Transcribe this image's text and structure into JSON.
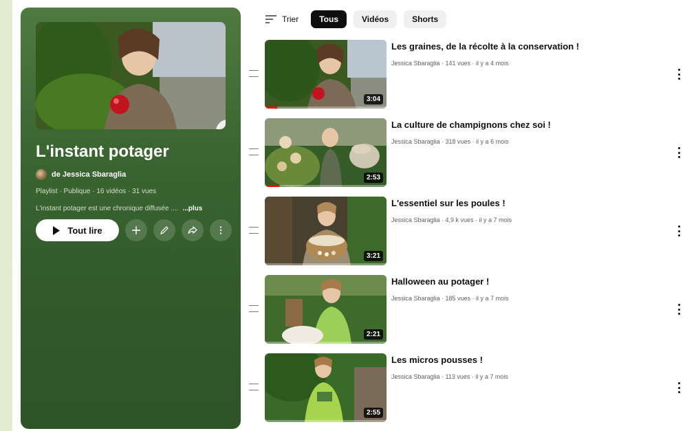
{
  "playlist": {
    "title": "L'instant potager",
    "owner": "de Jessica Sbaraglia",
    "meta": "Playlist · Publique · 16 vidéos · 31 vues",
    "description": "L'instant potager est une chronique diffusée ....",
    "description_more": "...plus",
    "play_all_label": "Tout lire",
    "hero_progress": 1.0
  },
  "filters": {
    "sort_label": "Trier",
    "chips": [
      "Tous",
      "Vidéos",
      "Shorts"
    ],
    "active": "Tous"
  },
  "videos": [
    {
      "title": "Les graines, de la récolte à la conservation !",
      "meta": "Jessica Sbaraglia · 141 vues · il y a 4 mois",
      "duration": "3:04",
      "progress": 0.1
    },
    {
      "title": "La culture de champignons chez soi !",
      "meta": "Jessica Sbaraglia · 318 vues · il y a 6 mois",
      "duration": "2:53",
      "progress": 0.12
    },
    {
      "title": "L'essentiel sur les poules !",
      "meta": "Jessica Sbaraglia · 4,9 k vues · il y a 7 mois",
      "duration": "3:21",
      "progress": 0.0
    },
    {
      "title": "Halloween au potager !",
      "meta": "Jessica Sbaraglia · 185 vues · il y a 7 mois",
      "duration": "2:21",
      "progress": 0.0
    },
    {
      "title": "Les micros pousses !",
      "meta": "Jessica Sbaraglia · 113 vues · il y a 7 mois",
      "duration": "2:55",
      "progress": 0.0
    }
  ],
  "colors": {
    "panel": "#3a6530",
    "progress": "#ff0000",
    "chip_active": "#0f0f0f"
  }
}
